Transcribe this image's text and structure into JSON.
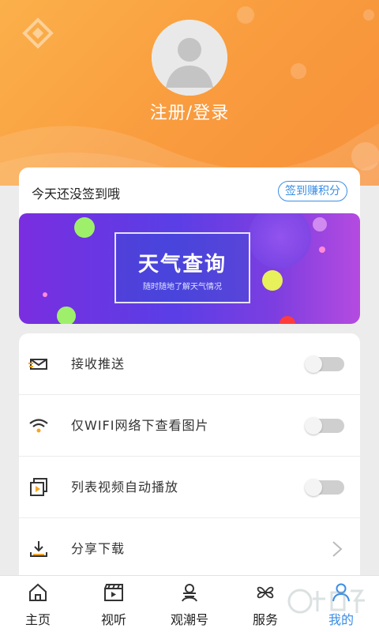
{
  "profile": {
    "login_label": "注册/登录"
  },
  "checkin": {
    "status": "今天还没签到哦",
    "button": "签到赚积分"
  },
  "banner": {
    "title": "天气查询",
    "subtitle": "随时随地了解天气情况"
  },
  "settings": [
    {
      "label": "接收推送",
      "icon": "envelope-icon",
      "type": "toggle",
      "on": false
    },
    {
      "label": "仅WIFI网络下查看图片",
      "icon": "wifi-icon",
      "type": "toggle",
      "on": false
    },
    {
      "label": "列表视频自动播放",
      "icon": "video-play-icon",
      "type": "toggle",
      "on": false
    },
    {
      "label": "分享下载",
      "icon": "download-icon",
      "type": "link"
    }
  ],
  "tabs": [
    {
      "label": "主页",
      "icon": "home-icon",
      "active": false
    },
    {
      "label": "视听",
      "icon": "clapperboard-icon",
      "active": false
    },
    {
      "label": "观潮号",
      "icon": "person-icon",
      "active": false
    },
    {
      "label": "服务",
      "icon": "grid-icon",
      "active": false
    },
    {
      "label": "我的",
      "icon": "user-icon",
      "active": true
    }
  ],
  "colors": {
    "accent": "#3a8ee6",
    "header": "#f99b3e"
  }
}
